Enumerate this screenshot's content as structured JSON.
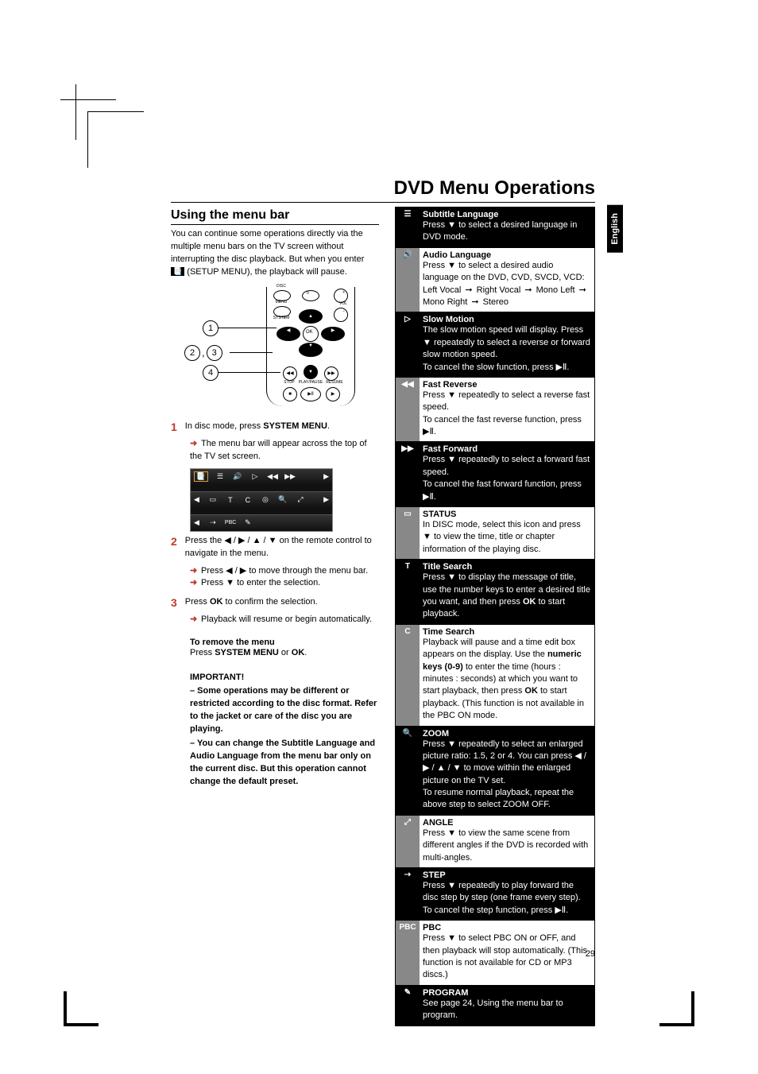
{
  "page": {
    "main_title": "DVD Menu Operations",
    "lang_tab": "English",
    "page_number": "29"
  },
  "left": {
    "section_title": "Using the menu bar",
    "intro_1": "You can continue some operations directly via the multiple menu bars on the TV screen without interrupting the disc playback. But when you enter ",
    "intro_icon": "📑",
    "intro_2": " (SETUP MENU), the playback will pause.",
    "remote": {
      "callouts": {
        "c1": "1",
        "c23": "2 , 3",
        "c4": "4"
      },
      "labels": {
        "disc": "DISC",
        "menu": "MENU",
        "system": "SYSTEM",
        "vol": "VOL",
        "ok": "OK",
        "stop": "STOP",
        "playpause": "PLAY/PAUSE",
        "resume": "RESUME",
        "zero": "0",
        "plus": "+",
        "minus": "−"
      }
    },
    "steps": {
      "s1_num": "1",
      "s1_pre": "In disc mode, press ",
      "s1_bold": "SYSTEM MENU",
      "s1_post": ".",
      "s1_sub": "The menu bar will appear across the top of the TV set screen.",
      "s2_num": "2",
      "s2_text": "Press the ◀ / ▶ / ▲ / ▼ on the remote control to navigate in the menu.",
      "s2_sub1": "Press ◀ / ▶ to move through the menu bar.",
      "s2_sub2": "Press ▼ to enter the selection.",
      "s3_num": "3",
      "s3_pre": "Press ",
      "s3_bold": "OK",
      "s3_post": " to confirm the selection.",
      "s3_sub": "Playback will resume or begin automatically."
    },
    "remove": {
      "title": "To remove the menu",
      "pre": "Press ",
      "b1": "SYSTEM MENU",
      "mid": " or ",
      "b2": "OK",
      "post": "."
    },
    "important": {
      "title": "IMPORTANT!",
      "p1": "–   Some operations may be different or restricted according to the disc format. Refer to the jacket or care of the disc you are playing.",
      "p2": "–   You can change the Subtitle Language and Audio Language from the menu bar only on the current disc. But this operation cannot change the default preset."
    }
  },
  "table": [
    {
      "style": "dark",
      "icon": "☰",
      "title": "Subtitle Language",
      "text": "Press ▼ to select a desired language in DVD mode."
    },
    {
      "style": "gray",
      "icon": "🔊",
      "title": "Audio Language",
      "text": "Press ▼ to select a desired audio language on the DVD, CVD, SVCD, VCD:",
      "seq": [
        "Left Vocal",
        "Right Vocal",
        "Mono Left",
        "Mono Right",
        "Stereo"
      ]
    },
    {
      "style": "dark",
      "icon": "▷",
      "title": "Slow Motion",
      "text": "The slow motion speed will display. Press ▼ repeatedly to select a reverse or forward slow motion speed.",
      "text2": "To cancel the slow function, press ▶Ⅱ."
    },
    {
      "style": "gray",
      "icon": "◀◀",
      "title": "Fast Reverse",
      "text": "Press ▼ repeatedly to select a reverse fast speed.",
      "text2": "To cancel the fast reverse function, press ▶Ⅱ."
    },
    {
      "style": "dark",
      "icon": "▶▶",
      "title": "Fast Forward",
      "text": "Press ▼ repeatedly to select a forward fast speed.",
      "text2": "To cancel the fast forward function, press ▶Ⅱ."
    },
    {
      "style": "gray",
      "icon": "▭",
      "title": "STATUS",
      "text": "In DISC mode, select this icon and press ▼ to view the time, title or chapter information of the playing disc."
    },
    {
      "style": "dark",
      "icon": "T",
      "title": "Title Search",
      "text_html": "Press ▼ to display the message of title, use the number keys to enter a desired title you want, and then press <b>OK</b> to start playback."
    },
    {
      "style": "gray",
      "icon": "C",
      "title": "Time Search",
      "text_html": "Playback will pause and a time edit box appears on the display. Use the <b>numeric keys (0-9)</b> to enter the time (hours : minutes : seconds) at which you want to start playback, then press <b>OK</b> to start playback. (This function is not available in the PBC ON mode."
    },
    {
      "style": "dark",
      "icon": "🔍",
      "title": "ZOOM",
      "text": "Press ▼ repeatedly to select an enlarged picture ratio: 1.5, 2 or 4. You can press ◀ / ▶ / ▲ / ▼ to move within the enlarged picture on the TV set.",
      "text2": "To resume normal playback, repeat the above step to select ZOOM OFF."
    },
    {
      "style": "gray",
      "icon": "⤢",
      "title": "ANGLE",
      "text": "Press ▼ to view the same scene from different angles  if the DVD is recorded with multi-angles."
    },
    {
      "style": "dark",
      "icon": "⇢",
      "title": "STEP",
      "text": "Press ▼ repeatedly to play forward the disc step by step (one frame every step). To cancel the step function, press ▶Ⅱ."
    },
    {
      "style": "gray",
      "icon": "PBC",
      "title": "PBC",
      "text": "Press ▼ to select PBC ON or OFF, and then playback will stop automatically. (This function is not available for CD or MP3 discs.)"
    },
    {
      "style": "dark",
      "icon": "✎",
      "title": "PROGRAM",
      "text": "See page 24, Using the menu bar to program."
    }
  ]
}
